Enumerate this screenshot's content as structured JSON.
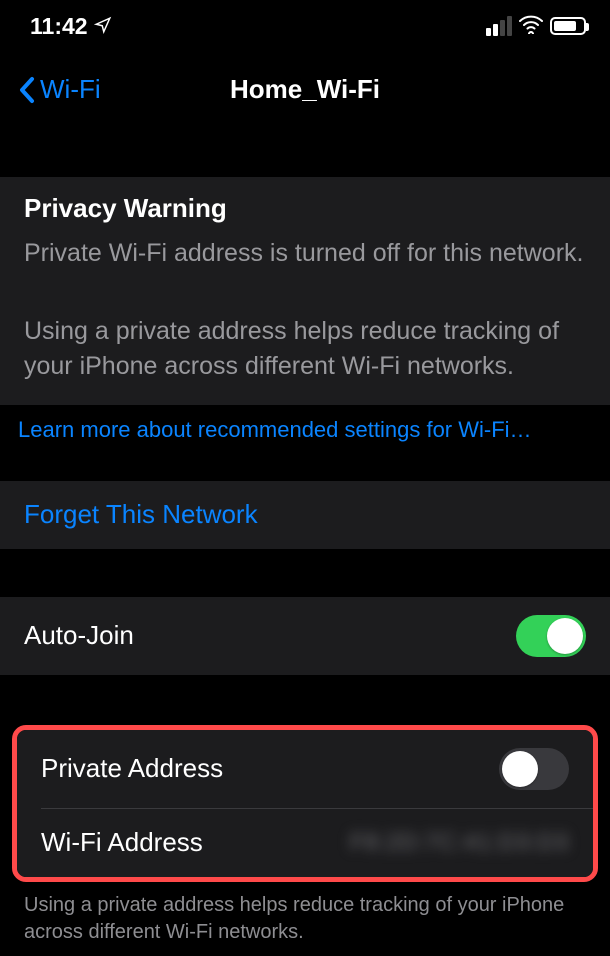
{
  "statusBar": {
    "time": "11:42"
  },
  "nav": {
    "back": "Wi-Fi",
    "title": "Home_Wi-Fi"
  },
  "warning": {
    "title": "Privacy Warning",
    "line1": "Private Wi-Fi address is turned off for this network.",
    "line2": "Using a private address helps reduce tracking of your iPhone across different Wi-Fi networks."
  },
  "learnMore": "Learn more about recommended settings for Wi-Fi…",
  "forget": "Forget This Network",
  "autoJoin": {
    "label": "Auto-Join",
    "on": true
  },
  "privateAddress": {
    "label": "Private Address",
    "on": false
  },
  "wifiAddress": {
    "label": "Wi-Fi Address",
    "value": "F8:2D:7C:41:D3:D3"
  },
  "footer": "Using a private address helps reduce tracking of your iPhone across different Wi-Fi networks."
}
